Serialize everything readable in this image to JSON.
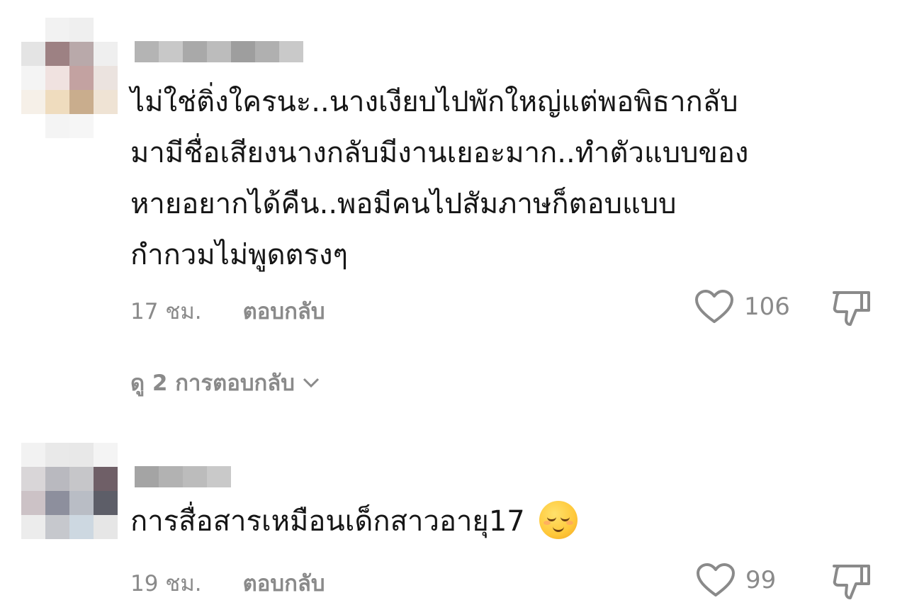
{
  "comments": [
    {
      "text": "ไม่ใช่ติ่งใครนะ..นางเงียบไปพักใหญ่แต่พอพิธากลับมามีชื่อเสียงนางกลับมีงานเยอะมาก..ทำตัวแบบของหายอยากได้คืน..พอมีคนไปสัมภาษก็ตอบแบบกำกวมไม่พูดตรงๆ",
      "lines": [
        "ไม่ใช่ติ่งใครนะ..นางเงียบไปพักใหญ่แต่พอพิธากลับ",
        "มามีชื่อเสียงนางกลับมีงานเยอะมาก..ทำตัวแบบของ",
        "หายอยากได้คืน..พอมีคนไปสัมภาษก็ตอบแบบ",
        "กำกวมไม่พูดตรงๆ"
      ],
      "time": "17 ชม.",
      "reply_label": "ตอบกลับ",
      "likes": "106",
      "view_replies": "ดู 2 การตอบกลับ"
    },
    {
      "text": "การสื่อสารเหมือนเด็กสาวอายุ17",
      "time": "19 ชม.",
      "reply_label": "ตอบกลับ",
      "likes": "99",
      "emoji": "relieved-face-emoji"
    }
  ],
  "colors": {
    "text": "#161616",
    "meta": "#8a8a8a",
    "background": "#ffffff"
  }
}
